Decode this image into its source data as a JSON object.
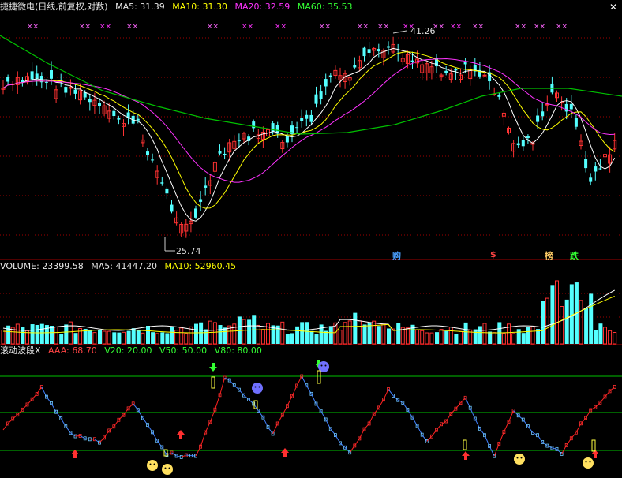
{
  "price_panel": {
    "title": "捷捷微电(日线,前复权,对数)",
    "ma5": "MA5: 31.39",
    "ma10": "MA10: 31.30",
    "ma20": "MA20: 32.59",
    "ma60": "MA60: 35.53",
    "high_label": "41.26",
    "low_label": "25.74",
    "markers": [
      "购",
      "$",
      "榜",
      "跌"
    ]
  },
  "volume_panel": {
    "volume": "VOLUME: 23399.58",
    "ma5": "MA5: 41447.20",
    "ma10": "MA10: 52960.45"
  },
  "indicator_panel": {
    "title": "滚动波段X",
    "aaa": "AAA: 68.70",
    "v20": "V20: 20.00",
    "v50": "V50: 50.00",
    "v80": "V80: 80.00"
  },
  "close_icon": "close-icon",
  "colors": {
    "up": "#ff3232",
    "down": "#54ffff",
    "ma5": "#ffffff",
    "ma10": "#ffff00",
    "ma20": "#ff33ff",
    "ma60": "#00c000",
    "level": "#00c000",
    "grid": "#a00000"
  },
  "chart_data": [
    {
      "type": "candlestick",
      "title": "捷捷微电(日线,前复权,对数)",
      "series": [
        {
          "name": "MA5",
          "last": 31.39
        },
        {
          "name": "MA10",
          "last": 31.3
        },
        {
          "name": "MA20",
          "last": 32.59
        },
        {
          "name": "MA60",
          "last": 35.53
        }
      ],
      "annotations": {
        "high": 41.26,
        "low": 25.74
      }
    },
    {
      "type": "bar",
      "title": "VOLUME",
      "series": [
        {
          "name": "VOLUME",
          "last": 23399.58
        },
        {
          "name": "MA5",
          "last": 41447.2
        },
        {
          "name": "MA10",
          "last": 52960.45
        }
      ]
    },
    {
      "type": "line",
      "title": "滚动波段X",
      "series": [
        {
          "name": "AAA",
          "last": 68.7
        },
        {
          "name": "V20",
          "last": 20.0
        },
        {
          "name": "V50",
          "last": 50.0
        },
        {
          "name": "V80",
          "last": 80.0
        }
      ],
      "ylim": [
        0,
        100
      ]
    }
  ]
}
